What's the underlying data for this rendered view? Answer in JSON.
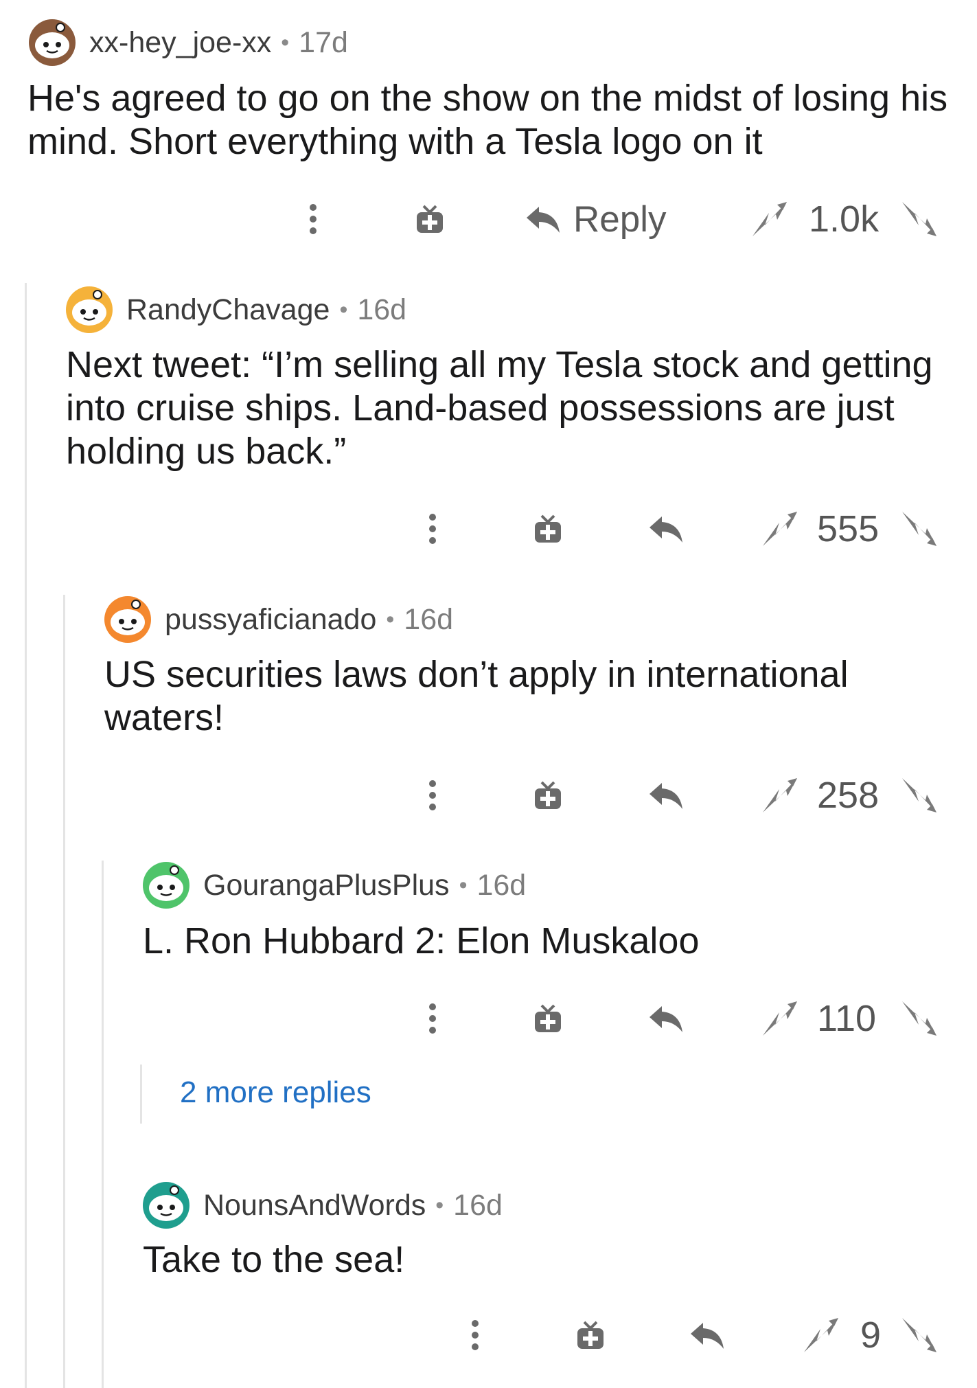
{
  "comments": [
    {
      "username": "xx-hey_joe-xx",
      "separator": "•",
      "age": "17d",
      "avatar_color": "#8a5a3c",
      "body": "He's agreed to go on the show on the midst of losing his\nmind. Short everything with a Tesla logo on it",
      "reply_label": "Reply",
      "score": "1.0k"
    },
    {
      "username": "RandyChavage",
      "separator": "•",
      "age": "16d",
      "avatar_color": "#f5b23a",
      "body": "Next tweet: “I’m selling all my Tesla stock and getting\ninto cruise ships. Land-based possessions are just\nholding us back.”",
      "score": "555"
    },
    {
      "username": "pussyaficianado",
      "separator": "•",
      "age": "16d",
      "avatar_color": "#f4882e",
      "body": "US securities laws don’t apply in international\nwaters!",
      "score": "258"
    },
    {
      "username": "GourangaPlusPlus",
      "separator": "•",
      "age": "16d",
      "avatar_color": "#4fc46a",
      "body": "L. Ron Hubbard 2: Elon Muskaloo",
      "score": "110"
    },
    {
      "username": "NounsAndWords",
      "separator": "•",
      "age": "16d",
      "avatar_color": "#1f9e8e",
      "body": "Take to the sea!",
      "score": "9"
    }
  ],
  "more_replies": "2 more replies",
  "icons": {
    "more": "more-options-icon",
    "award": "gift-award-icon",
    "reply": "reply-arrow-icon",
    "upvote": "upvote-arrow-icon",
    "downvote": "downvote-arrow-icon"
  }
}
